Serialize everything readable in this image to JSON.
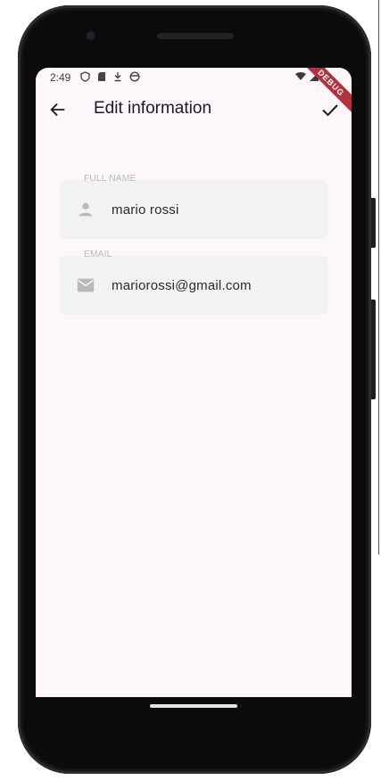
{
  "statusbar": {
    "time": "2:49",
    "debug_label": "DEBUG"
  },
  "appbar": {
    "title": "Edit information"
  },
  "fields": {
    "full_name": {
      "label": "FULL NAME",
      "value": "mario rossi",
      "icon": "person-icon"
    },
    "email": {
      "label": "EMAIL",
      "value": "mariorossi@gmail.com",
      "icon": "mail-icon"
    }
  },
  "colors": {
    "background": "#fdf7fb",
    "field_fill": "#f2f1f3",
    "debug_ribbon": "#b2333f"
  }
}
